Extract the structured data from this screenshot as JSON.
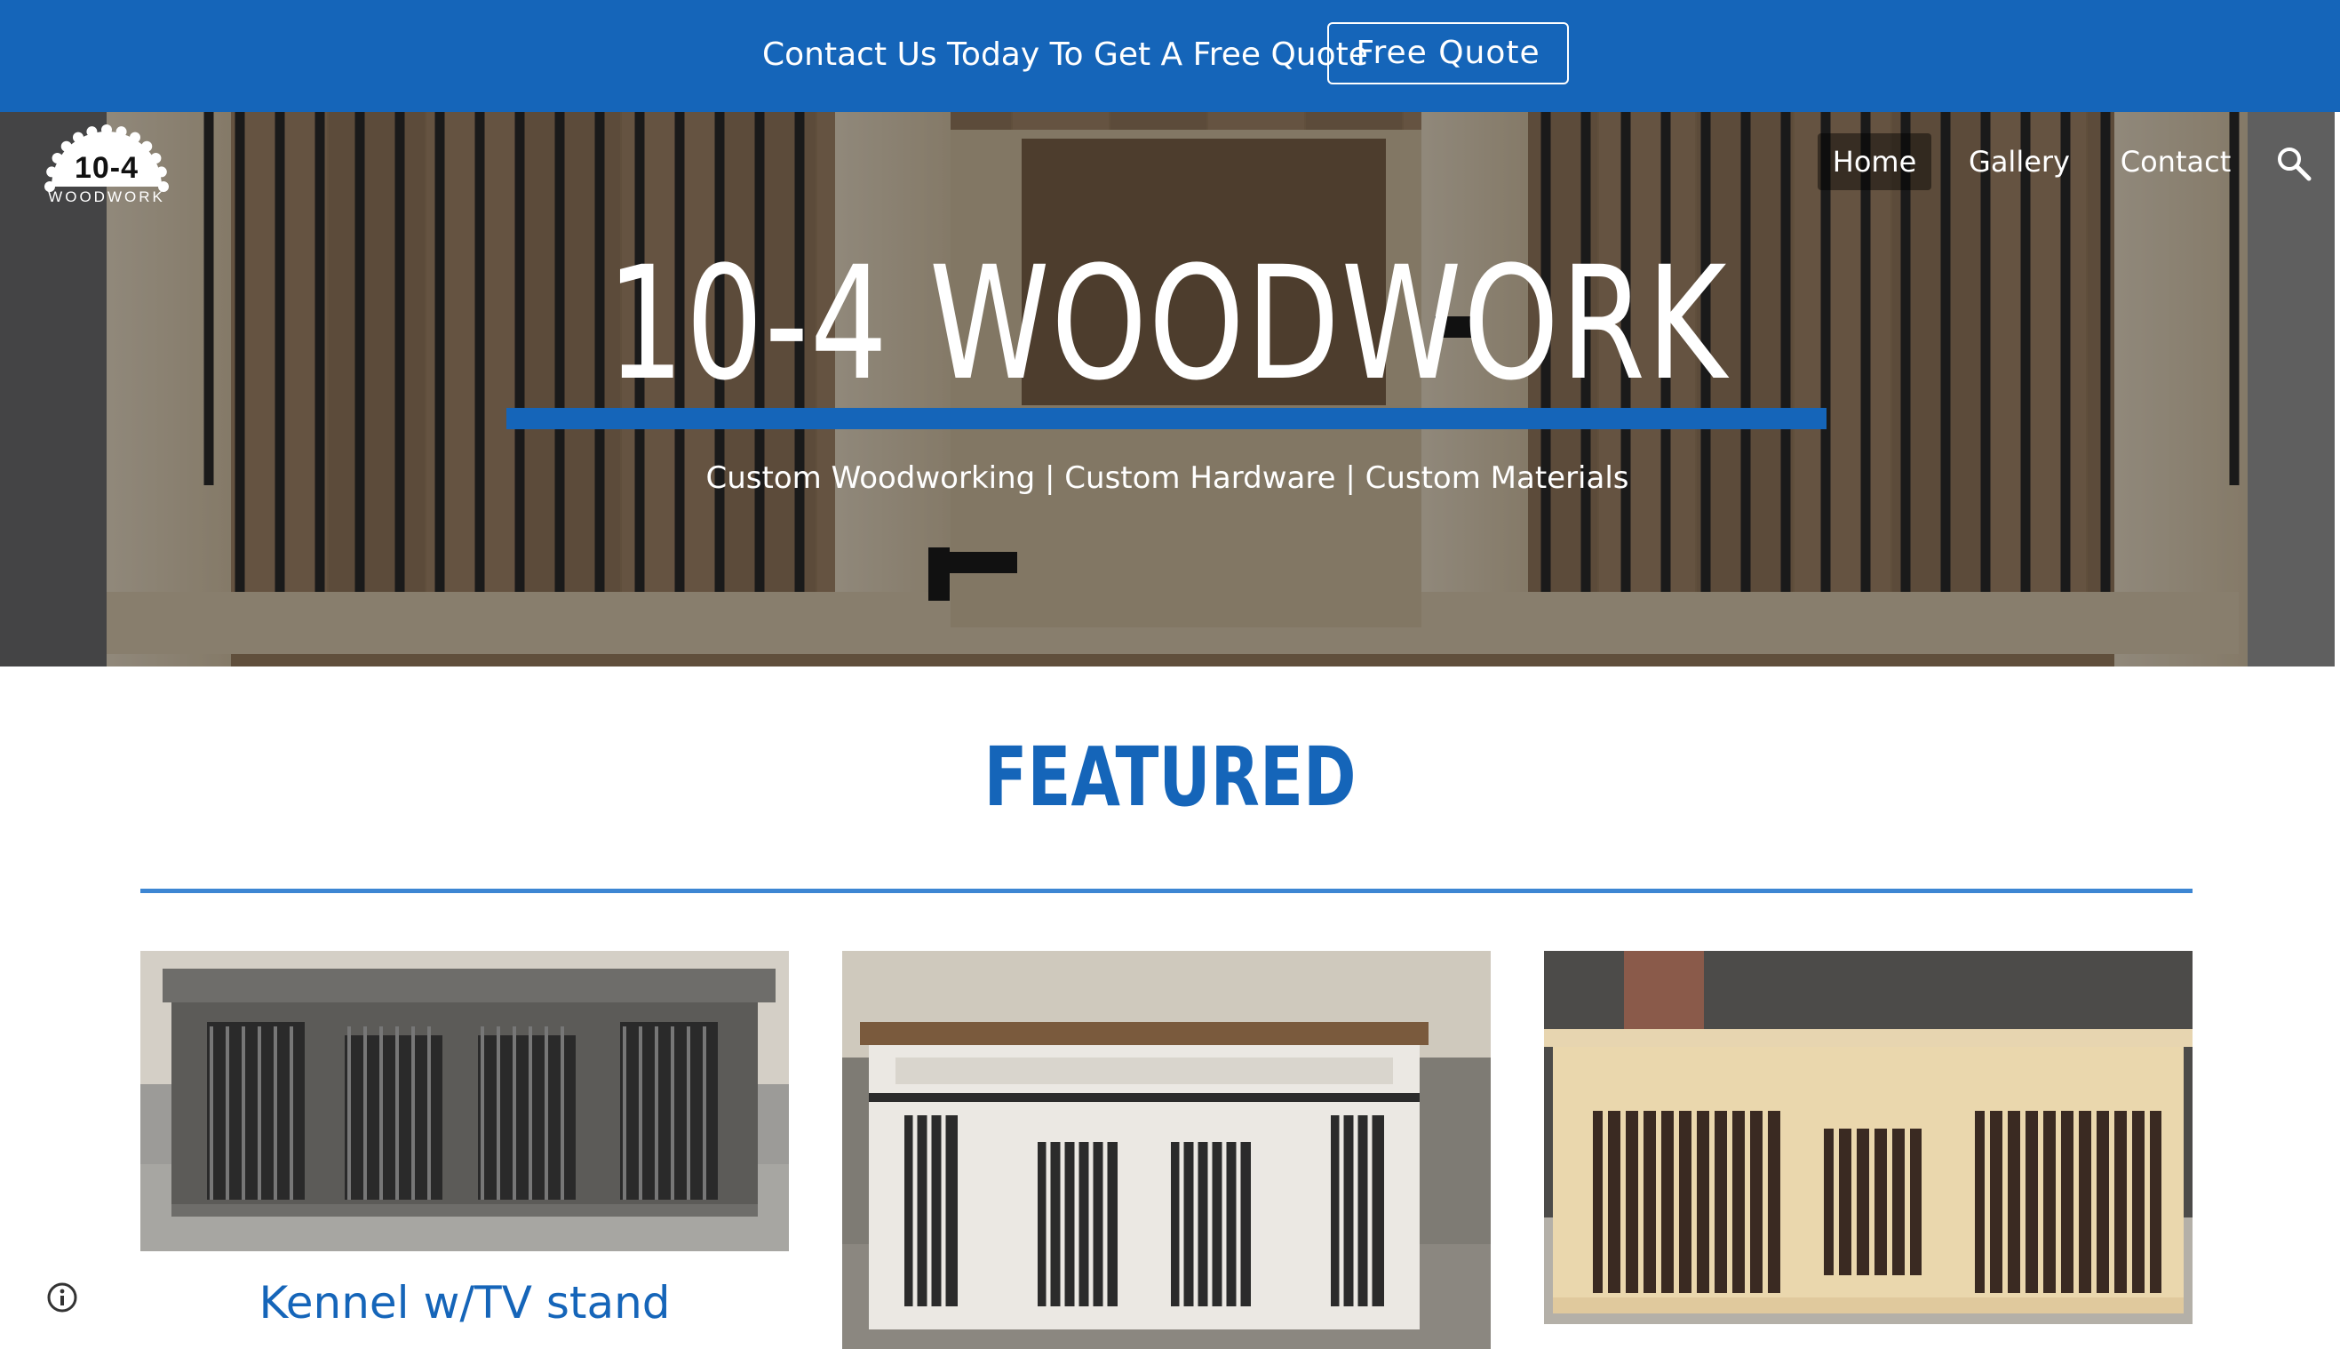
{
  "topbar": {
    "text": "Contact Us Today To Get A Free Quote",
    "button_label": "Free Quote",
    "color": "#1565b9"
  },
  "logo": {
    "number": "10-4",
    "word": "WOODWORK",
    "icon": "saw-blade-icon"
  },
  "nav": {
    "items": [
      {
        "label": "Home",
        "active": true
      },
      {
        "label": "Gallery",
        "active": false
      },
      {
        "label": "Contact",
        "active": false
      }
    ],
    "search_icon": "search-icon"
  },
  "hero": {
    "title": "10-4 WOODWORK",
    "subtitle": "Custom Woodworking | Custom Hardware | Custom Materials",
    "accent": "#1565b9"
  },
  "featured": {
    "title": "FEATURED",
    "cards": [
      {
        "caption": "Kennel w/TV stand",
        "image": "grey-stained-kennel-photo"
      },
      {
        "caption": "",
        "image": "white-kennel-tv-stand-photo"
      },
      {
        "caption": "",
        "image": "natural-pine-kennel-photo"
      }
    ]
  },
  "footer": {
    "info_icon": "info-icon"
  }
}
